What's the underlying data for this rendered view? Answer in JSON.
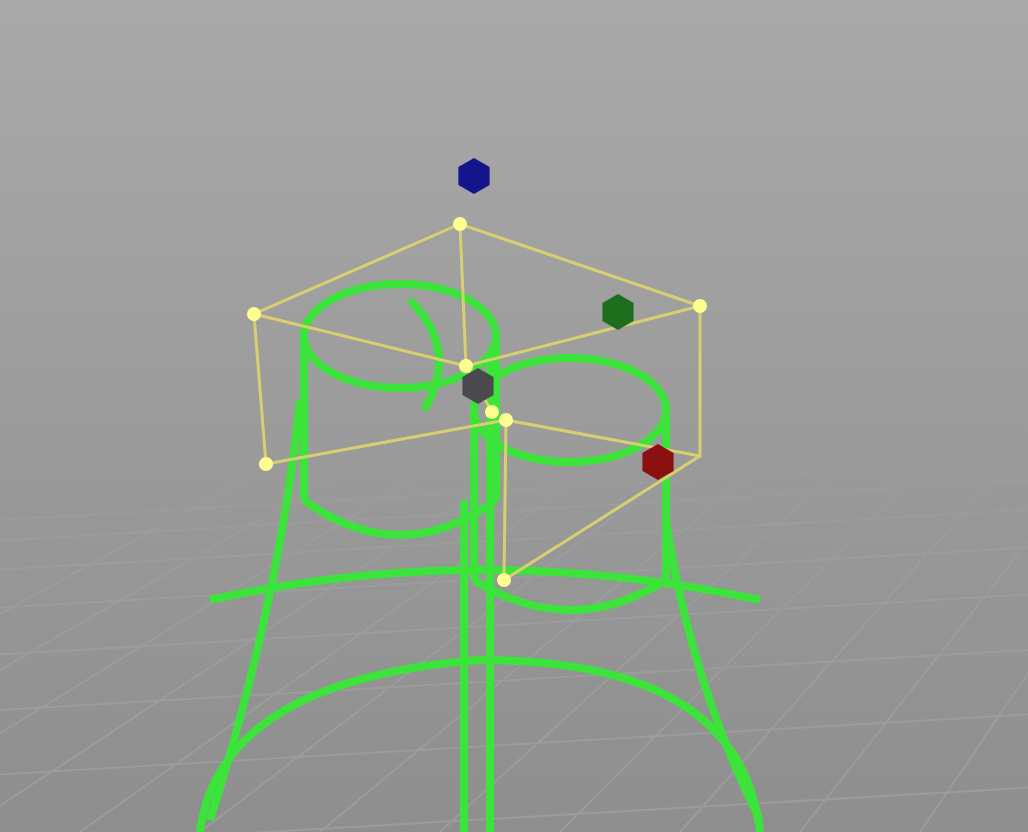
{
  "viewport": {
    "handles": [
      {
        "kind": "top",
        "color": "#14148c"
      },
      {
        "kind": "side",
        "color": "#1e6e1e"
      },
      {
        "kind": "center",
        "color": "#4a4a4e"
      },
      {
        "kind": "front",
        "color": "#8c1010"
      }
    ]
  }
}
